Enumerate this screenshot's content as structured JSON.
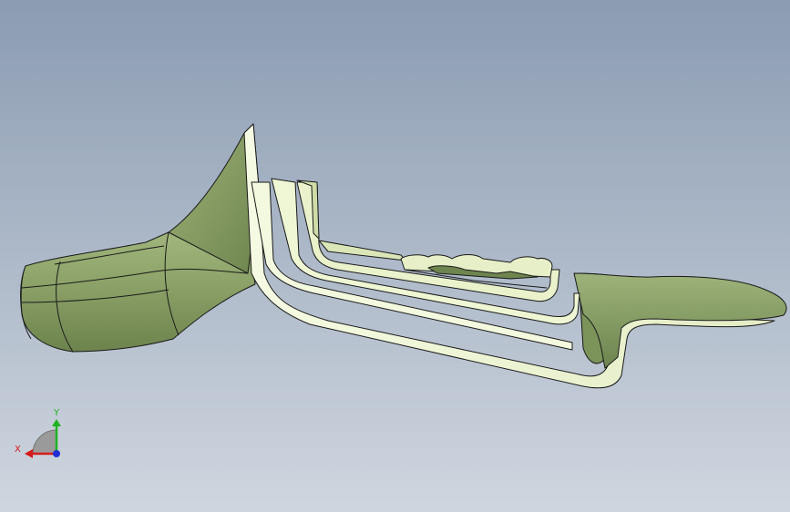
{
  "viewport": {
    "background_top": "#8c9db3",
    "background_bottom": "#cdd4dd",
    "model_color_shaded": "#8fa86a",
    "model_color_light": "#eef5d6",
    "edge_color": "#1a1a1a"
  },
  "triad": {
    "x_label": "X",
    "y_label": "Y",
    "x_color": "#d61a1a",
    "y_color": "#1fb31f",
    "z_color": "#1f2fd6"
  }
}
